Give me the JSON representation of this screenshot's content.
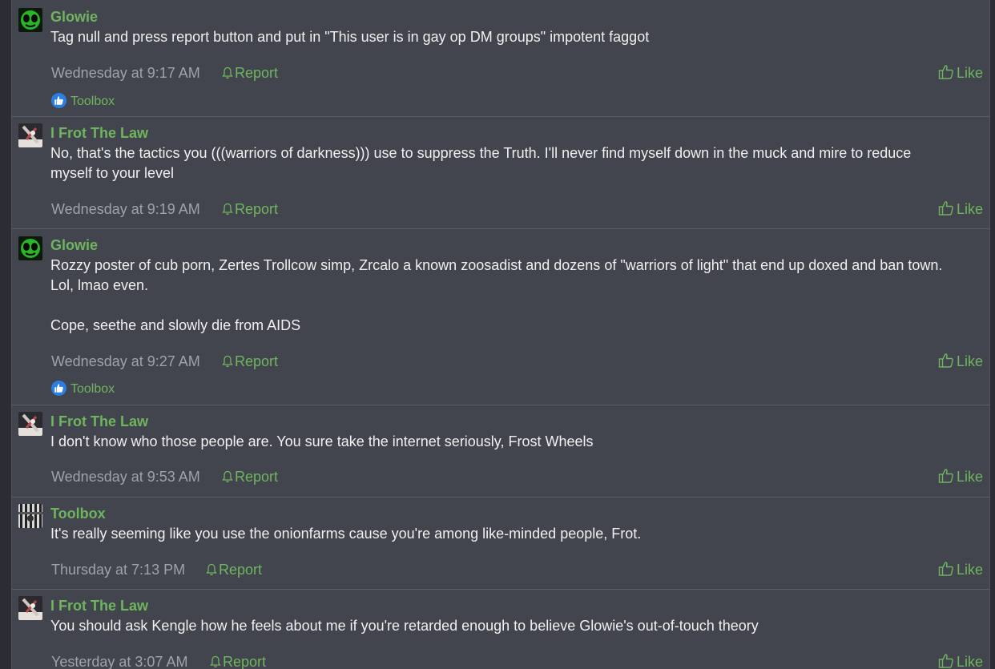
{
  "actions": {
    "report_label": "Report",
    "like_label": "Like"
  },
  "colors": {
    "accent": "#6fb45e",
    "panel": "#42454e",
    "text": "#f0f0f0",
    "muted": "#9ea2aa",
    "reaction": "#2b7fe0"
  },
  "posts": [
    {
      "author": "Glowie",
      "avatar_icon": "green-alien-avatar-icon",
      "lines": [
        "Tag null and press report button and put in \"This user is in gay op DM groups\" impotent faggot"
      ],
      "timestamp": "Wednesday at 9:17 AM",
      "reaction_user": "Toolbox"
    },
    {
      "author": "I Frot The Law",
      "avatar_icon": "figure-avatar-icon",
      "lines": [
        "No, that's the tactics you (((warriors of darkness))) use to suppress the Truth. I'll never find myself down in the muck and mire to reduce",
        "myself to your level"
      ],
      "timestamp": "Wednesday at 9:19 AM"
    },
    {
      "author": "Glowie",
      "avatar_icon": "green-alien-avatar-icon",
      "lines": [
        "Rozzy poster of cub porn, Zertes Trollcow simp, Zrcalo a known zoosadist and dozens of \"warriors of light\" that end up doxed and ban town.",
        "Lol, lmao even.",
        "",
        "Cope, seethe and slowly die from AIDS"
      ],
      "timestamp": "Wednesday at 9:27 AM",
      "reaction_user": "Toolbox"
    },
    {
      "author": "I Frot The Law",
      "avatar_icon": "figure-avatar-icon",
      "lines": [
        "I don't know who those people are. You sure take the internet seriously, Frost Wheels"
      ],
      "timestamp": "Wednesday at 9:53 AM"
    },
    {
      "author": "Toolbox",
      "avatar_icon": "striped-avatar-icon",
      "lines": [
        "It's really seeming like you use the onionfarms cause you're among like-minded people, Frot."
      ],
      "timestamp": "Thursday at 7:13 PM"
    },
    {
      "author": "I Frot The Law",
      "avatar_icon": "figure-avatar-icon",
      "lines": [
        "You should ask Kengle how he feels about me if you're retarded enough to believe Glowie's out-of-touch theory"
      ],
      "timestamp": "Yesterday at 3:07 AM"
    }
  ]
}
